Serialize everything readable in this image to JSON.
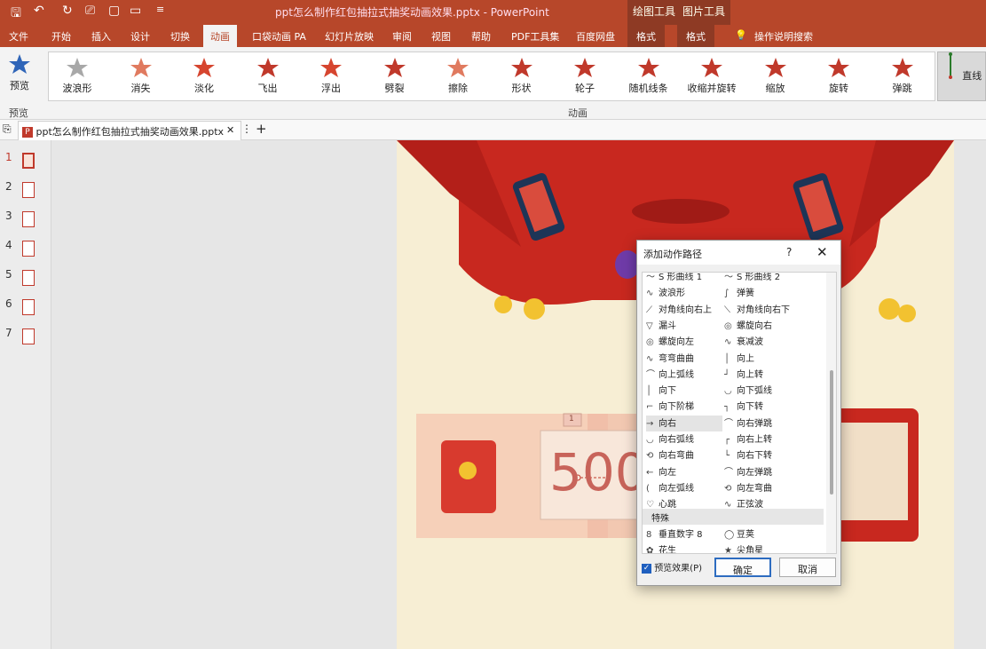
{
  "title_bar": {
    "title": "ppt怎么制作红包抽拉式抽奖动画效果.pptx  -  PowerPoint",
    "ctx_draw": "绘图工具",
    "ctx_pic": "图片工具"
  },
  "menu": [
    "文件",
    "开始",
    "插入",
    "设计",
    "切换",
    "动画",
    "口袋动画 PA",
    "幻灯片放映",
    "审阅",
    "视图",
    "帮助",
    "PDF工具集",
    "百度网盘"
  ],
  "menu_format": [
    "格式",
    "格式"
  ],
  "menu_search": "操作说明搜索",
  "ribbon": {
    "preview_label": "预览",
    "preview_group": "预览",
    "animations_group": "动画",
    "animations": [
      "波浪形",
      "消失",
      "淡化",
      "飞出",
      "浮出",
      "劈裂",
      "擦除",
      "形状",
      "轮子",
      "随机线条",
      "收缩并旋转",
      "缩放",
      "旋转",
      "弹跳"
    ],
    "selected": "直线"
  },
  "doc_tab": {
    "name": "ppt怎么制作红包抽拉式抽奖动画效果.pptx"
  },
  "slides": [
    "1",
    "2",
    "3",
    "4",
    "5",
    "6",
    "7"
  ],
  "slide_content": {
    "amount": "500",
    "badge": "1"
  },
  "dialog": {
    "title": "添加动作路径",
    "help": "?",
    "close": "✕",
    "left_items": [
      {
        "icon": "〜",
        "label": "S 形曲线 1"
      },
      {
        "icon": "∿",
        "label": "波浪形"
      },
      {
        "icon": "⟋",
        "label": "对角线向右上"
      },
      {
        "icon": "▽",
        "label": "漏斗"
      },
      {
        "icon": "◎",
        "label": "螺旋向左"
      },
      {
        "icon": "∿",
        "label": "弯弯曲曲"
      },
      {
        "icon": "⌒",
        "label": "向上弧线"
      },
      {
        "icon": "│",
        "label": "向下"
      },
      {
        "icon": "⌐",
        "label": "向下阶梯"
      },
      {
        "icon": "→",
        "label": "向右"
      },
      {
        "icon": "◡",
        "label": "向右弧线"
      },
      {
        "icon": "⟲",
        "label": "向右弯曲"
      },
      {
        "icon": "←",
        "label": "向左"
      },
      {
        "icon": "(",
        "label": "向左弧线"
      },
      {
        "icon": "♡",
        "label": "心跳"
      }
    ],
    "right_items": [
      {
        "icon": "〜",
        "label": "S 形曲线 2"
      },
      {
        "icon": "∫",
        "label": "弹簧"
      },
      {
        "icon": "⟍",
        "label": "对角线向右下"
      },
      {
        "icon": "◎",
        "label": "螺旋向右"
      },
      {
        "icon": "∿",
        "label": "衰减波"
      },
      {
        "icon": "│",
        "label": "向上"
      },
      {
        "icon": "┘",
        "label": "向上转"
      },
      {
        "icon": "◡",
        "label": "向下弧线"
      },
      {
        "icon": "┐",
        "label": "向下转"
      },
      {
        "icon": "⌒",
        "label": "向右弹跳"
      },
      {
        "icon": "┌",
        "label": "向右上转"
      },
      {
        "icon": "└",
        "label": "向右下转"
      },
      {
        "icon": "⌒",
        "label": "向左弹跳"
      },
      {
        "icon": "⟲",
        "label": "向左弯曲"
      },
      {
        "icon": "∿",
        "label": "正弦波"
      }
    ],
    "section": "特殊",
    "special_left": [
      {
        "icon": "8",
        "label": "垂直数字 8"
      },
      {
        "icon": "✿",
        "label": "花生"
      }
    ],
    "special_right": [
      {
        "icon": "◯",
        "label": "豆荚"
      },
      {
        "icon": "★",
        "label": "尖角星"
      }
    ],
    "preview_effect": "预览效果(P)",
    "ok": "确定",
    "cancel": "取消"
  },
  "colors": {
    "brand": "#b7472a",
    "accent_red": "#c0392b",
    "slide_bg": "#f7eed4"
  }
}
